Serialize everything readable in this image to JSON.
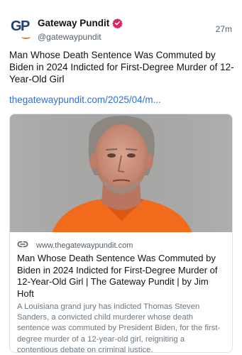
{
  "post": {
    "author": {
      "avatar_letters": "GP",
      "display_name": "Gateway Pundit",
      "handle": "@gatewaypundit",
      "verified_icon": "verified-badge-icon"
    },
    "timestamp": "27m",
    "text": "Man Whose Death Sentence Was Commuted by Biden in 2024 Indicted for First-Degree Murder of 12-Year-Old Girl",
    "link": "thegatewaypundit.com/2025/04/m..."
  },
  "card": {
    "image_alt": "mugshot photo",
    "domain_icon": "link-icon",
    "domain": "www.thegatewaypundit.com",
    "title": "Man Whose Death Sentence Was Commuted by Biden in 2024 Indicted for First-Degree Murder of 12-Year-Old Girl | The Gateway Pundit | by Jim Hoft",
    "description": "A Louisiana grand jury has indicted Thomas Steven Sanders, a convicted child murderer whose death sentence was commuted by President Biden, for the first-degree murder of a 12-year-old girl, reigniting a contentious debate on criminal justice."
  },
  "colors": {
    "link": "#2f6fd1",
    "verified": "#e0245e",
    "avatar": "#24406e",
    "shirt": "#f26a1b"
  }
}
